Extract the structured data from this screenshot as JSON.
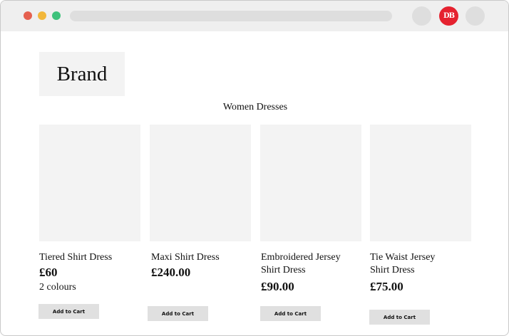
{
  "browser": {
    "logo_text": "DB"
  },
  "header": {
    "brand": "Brand"
  },
  "category": {
    "title": "Women Dresses"
  },
  "products": [
    {
      "name": "Tiered Shirt Dress",
      "price": "£60",
      "colours": "2 colours",
      "cta": "Add to Cart"
    },
    {
      "name": "Maxi Shirt Dress",
      "price": "£240.00",
      "cta": "Add to Cart"
    },
    {
      "name": "Embroidered Jersey Shirt Dress",
      "price": "£90.00",
      "cta": "Add to Cart"
    },
    {
      "name": "Tie Waist Jersey Shirt Dress",
      "price": "£75.00",
      "cta": "Add to Cart"
    }
  ],
  "colors": {
    "chrome": "#efefef",
    "placeholder": "#f3f3f3",
    "button": "#e0e0e0",
    "close_dot": "#e5604f",
    "minimize_dot": "#f2b73b",
    "maximize_dot": "#3fc27c",
    "logo_badge": "#e5222f"
  }
}
